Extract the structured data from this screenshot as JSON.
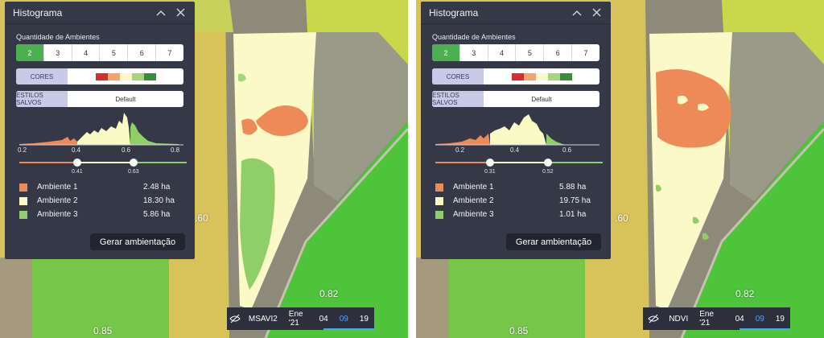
{
  "panels": [
    {
      "title": "Histograma",
      "section_label": "Quantidade de Ambientes",
      "segments": [
        "2",
        "3",
        "4",
        "5",
        "6",
        "7"
      ],
      "cores_label": "CORES",
      "estilos_label": "ESTILOS SALVOS",
      "estilos_value": "Default",
      "axis_ticks": [
        "0.2",
        "0.4",
        "0.6",
        "0.8"
      ],
      "thresholds": [
        "0.41",
        "0.63"
      ],
      "legend": [
        {
          "name": "Ambiente 1",
          "ha": "2.48 ha",
          "color": "#ee8a58"
        },
        {
          "name": "Ambiente 2",
          "ha": "18.30 ha",
          "color": "#fafbc4"
        },
        {
          "name": "Ambiente 3",
          "ha": "5.86 ha",
          "color": "#8fcf68"
        }
      ],
      "button_label": "Gerar ambientação",
      "bottom_bar": {
        "index": "MSAVI2",
        "month": "Ene '21",
        "days": [
          "04",
          "09",
          "19"
        ]
      }
    },
    {
      "title": "Histograma",
      "section_label": "Quantidade de Ambientes",
      "segments": [
        "2",
        "3",
        "4",
        "5",
        "6",
        "7"
      ],
      "cores_label": "CORES",
      "estilos_label": "ESTILOS SALVOS",
      "estilos_value": "Default",
      "axis_ticks": [
        "0.2",
        "0.4",
        "0.6"
      ],
      "thresholds": [
        "0.31",
        "0.52"
      ],
      "legend": [
        {
          "name": "Ambiente 1",
          "ha": "5.88 ha",
          "color": "#ee8a58"
        },
        {
          "name": "Ambiente 2",
          "ha": "19.75 ha",
          "color": "#fafbc4"
        },
        {
          "name": "Ambiente 3",
          "ha": "1.01 ha",
          "color": "#8fcf68"
        }
      ],
      "button_label": "Gerar ambientação",
      "bottom_bar": {
        "index": "NDVI",
        "month": "Ene '21",
        "days": [
          "04",
          "09",
          "19"
        ]
      }
    }
  ],
  "map_labels": [
    ".60",
    "0.82",
    "0.85"
  ],
  "colors": {
    "panel_bg": "#353847",
    "active_segment": "#4caf50",
    "ambiente_1": "#ee8a58",
    "ambiente_2": "#fafbc4",
    "ambiente_3": "#8fcf68",
    "active_day": "#4aa3ff"
  },
  "cores_palette": [
    "#d32f2f",
    "#f2a46a",
    "#f8f8c8",
    "#a5d67c",
    "#388e3c"
  ]
}
